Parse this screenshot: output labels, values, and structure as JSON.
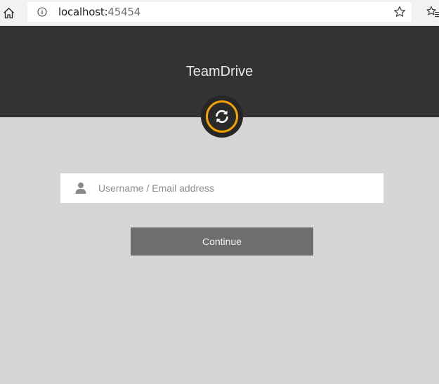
{
  "browser": {
    "url_host": "localhost:",
    "url_port": "45454",
    "icons": {
      "home": "home-icon",
      "info": "info-icon",
      "favorite": "favorite-star-icon",
      "favorites_list": "favorites-list-icon"
    }
  },
  "header": {
    "title": "TeamDrive",
    "logo_icon": "sync-icon",
    "accent_color": "#f5a100",
    "background_color": "#333333"
  },
  "login": {
    "username_placeholder": "Username / Email address",
    "username_value": "",
    "user_icon": "user-icon",
    "continue_label": "Continue"
  }
}
